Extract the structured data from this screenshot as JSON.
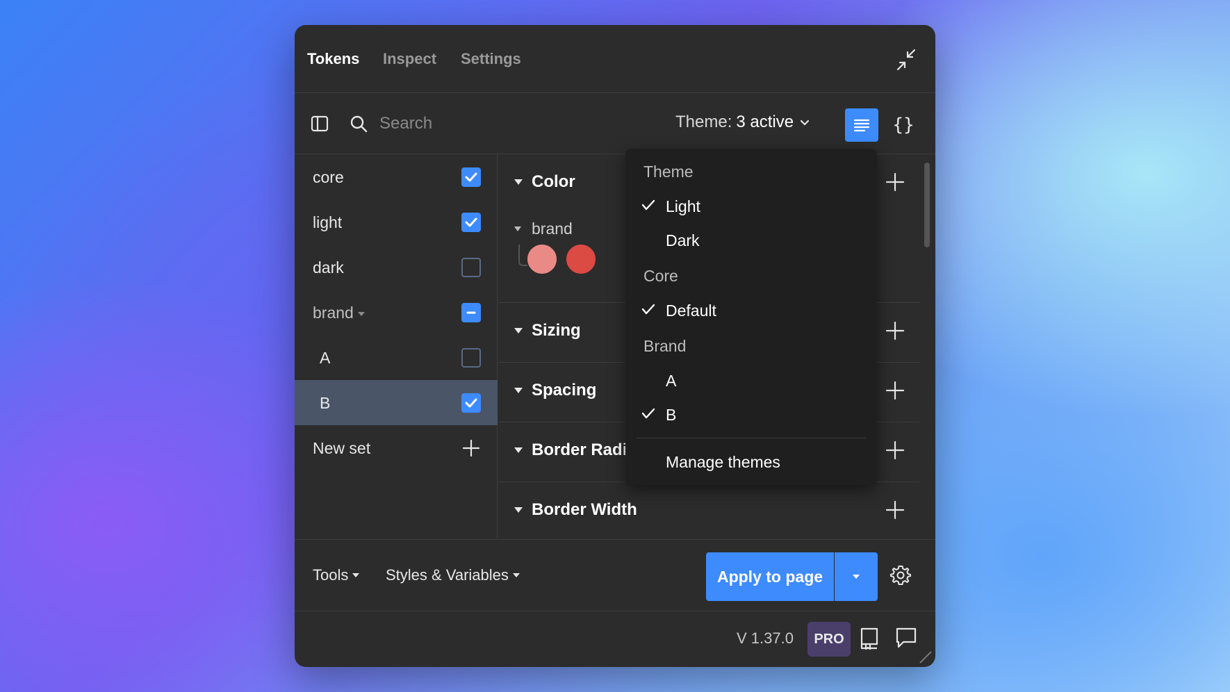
{
  "tabs": [
    {
      "label": "Tokens",
      "active": true
    },
    {
      "label": "Inspect",
      "active": false
    },
    {
      "label": "Settings",
      "active": false
    }
  ],
  "toolbar": {
    "search_placeholder": "Search",
    "theme_label": "Theme:",
    "theme_value": "3 active"
  },
  "sets": [
    {
      "label": "core",
      "state": "checked"
    },
    {
      "label": "light",
      "state": "checked"
    },
    {
      "label": "dark",
      "state": "unchecked"
    },
    {
      "label": "brand",
      "state": "mixed"
    },
    {
      "label": "A",
      "state": "unchecked"
    },
    {
      "label": "B",
      "state": "checked",
      "selected": true
    }
  ],
  "new_set_label": "New set",
  "groups": {
    "color": "Color",
    "brand": "brand",
    "sizing": "Sizing",
    "spacing": "Spacing",
    "border_radius": "Border Radiu",
    "border_width": "Border Width"
  },
  "swatch_colors": [
    "#ea8a87",
    "#dc4a44"
  ],
  "footer": {
    "tools": "Tools",
    "styles": "Styles & Variables",
    "apply": "Apply to page"
  },
  "status": {
    "version": "V 1.37.0",
    "pro": "PRO"
  },
  "theme_menu": {
    "groups": [
      {
        "heading": "Theme",
        "items": [
          {
            "label": "Light",
            "checked": true
          },
          {
            "label": "Dark",
            "checked": false
          }
        ]
      },
      {
        "heading": "Core",
        "items": [
          {
            "label": "Default",
            "checked": true
          }
        ]
      },
      {
        "heading": "Brand",
        "items": [
          {
            "label": "A",
            "checked": false
          },
          {
            "label": "B",
            "checked": true
          }
        ]
      }
    ],
    "manage": "Manage themes"
  },
  "colors": {
    "accent": "#3d8bfd",
    "panel": "#2c2c2c",
    "dropdown": "#1f1f1f"
  }
}
